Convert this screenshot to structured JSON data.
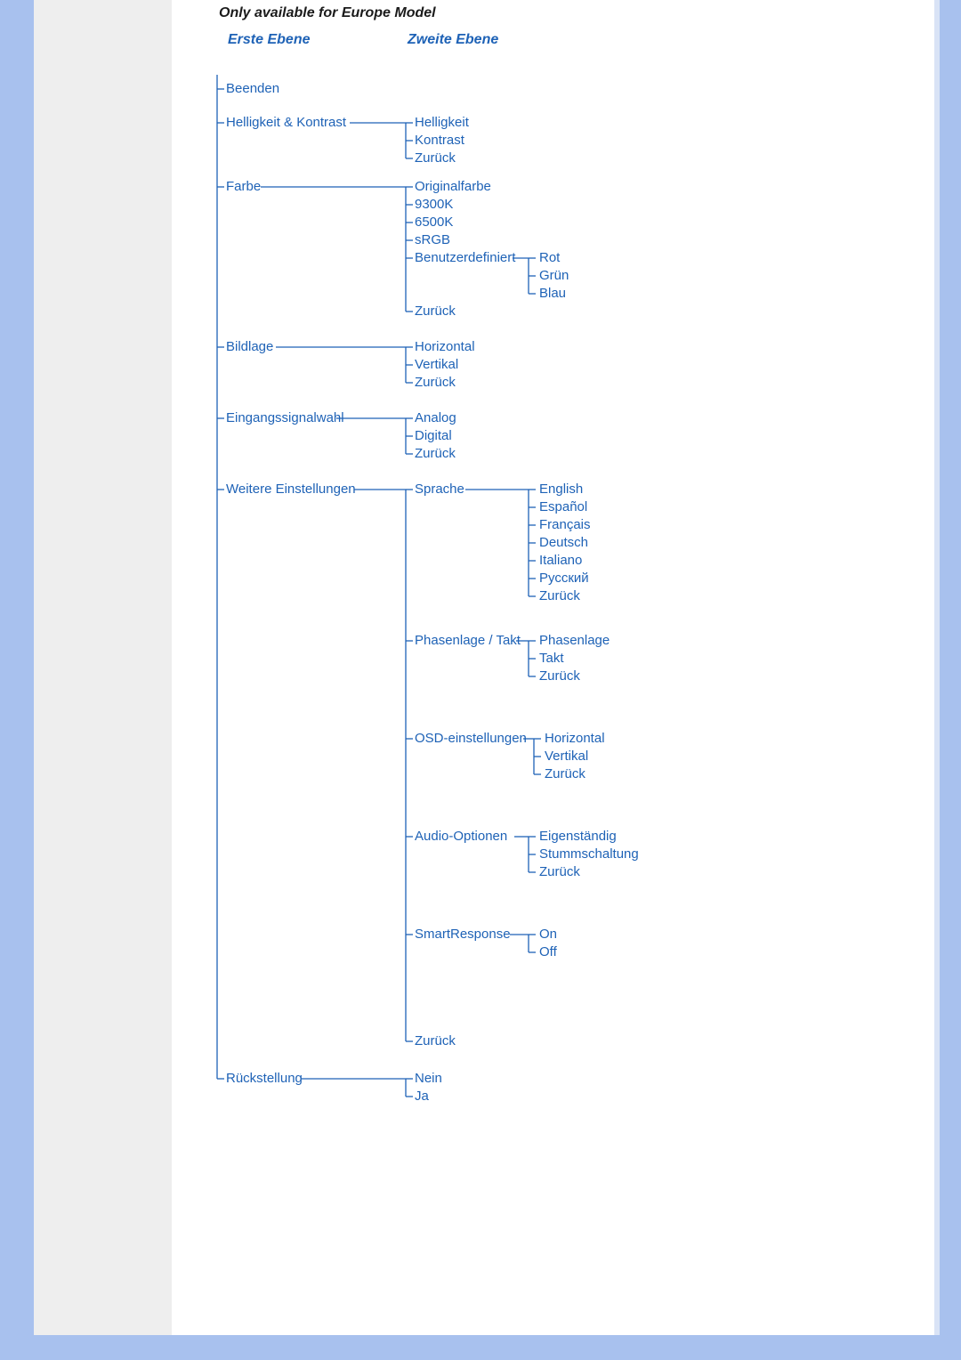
{
  "title": "Only available for Europe Model",
  "headers": {
    "first": "Erste Ebene",
    "second": "Zweite Ebene"
  },
  "level1": {
    "beenden": "Beenden",
    "helligkeit_kontrast": "Helligkeit & Kontrast",
    "farbe": "Farbe",
    "bildlage": "Bildlage",
    "eingang": "Eingangssignalwahl",
    "weitere": "Weitere Einstellungen",
    "rueck": "Rückstellung"
  },
  "hk": {
    "helligkeit": "Helligkeit",
    "kontrast": "Kontrast",
    "zurueck": "Zurück"
  },
  "farbe": {
    "original": "Originalfarbe",
    "k93": "9300K",
    "k65": "6500K",
    "srgb": "sRGB",
    "benutzer": "Benutzerdefiniert",
    "zurueck": "Zurück",
    "rgb": {
      "rot": "Rot",
      "gruen": "Grün",
      "blau": "Blau"
    }
  },
  "bildlage": {
    "horizontal": "Horizontal",
    "vertikal": "Vertikal",
    "zurueck": "Zurück"
  },
  "eingang": {
    "analog": "Analog",
    "digital": "Digital",
    "zurueck": "Zurück"
  },
  "weitere": {
    "sprache": "Sprache",
    "sprachen": {
      "en": "English",
      "es": "Español",
      "fr": "Français",
      "de": "Deutsch",
      "it": "Italiano",
      "ru": "Русский",
      "zurueck": "Zurück"
    },
    "phasetakt": "Phasenlage / Takt",
    "pt": {
      "phase": "Phasenlage",
      "takt": "Takt",
      "zurueck": "Zurück"
    },
    "osd": "OSD-einstellungen",
    "osd_items": {
      "h": "Horizontal",
      "v": "Vertikal",
      "z": "Zurück"
    },
    "audio": "Audio-Optionen",
    "audio_items": {
      "eigen": "Eigenständig",
      "stumm": "Stummschaltung",
      "z": "Zurück"
    },
    "smart": "SmartResponse",
    "smart_items": {
      "on": "On",
      "off": "Off"
    },
    "zurueck": "Zurück"
  },
  "rueck": {
    "nein": "Nein",
    "ja": "Ja"
  }
}
